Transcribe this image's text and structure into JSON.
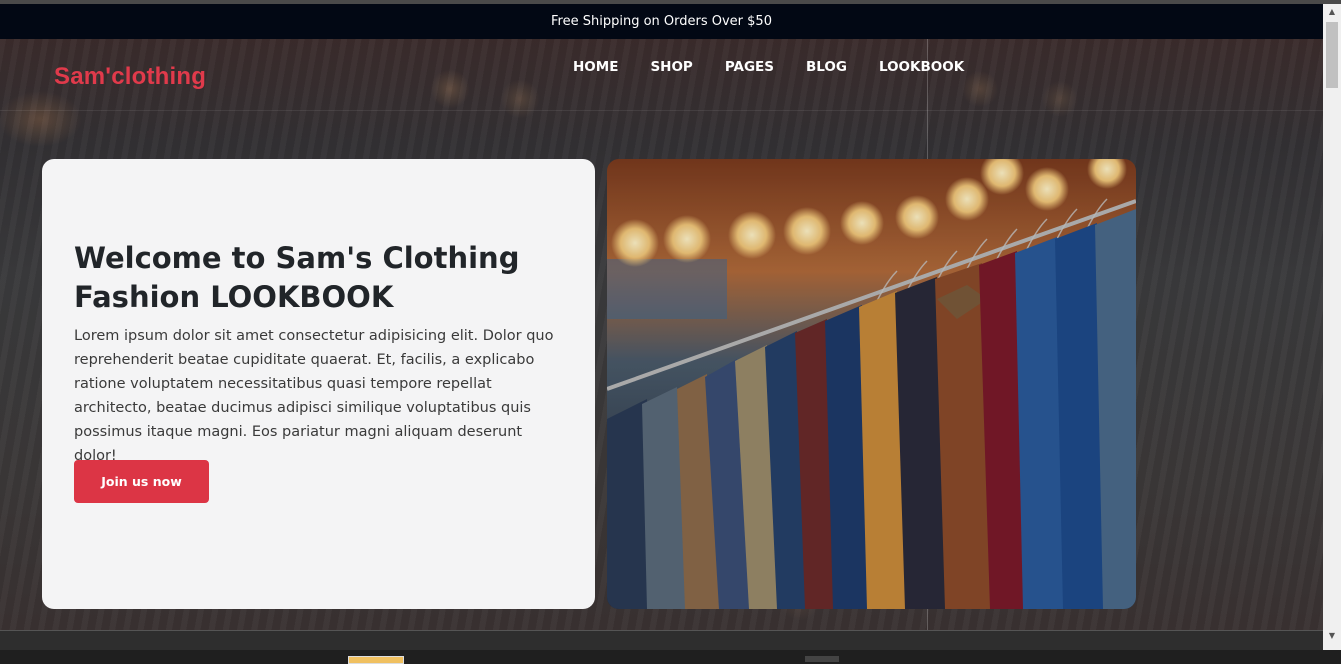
{
  "announcement": "Free Shipping on Orders Over $50",
  "brand": "Sam'clothing",
  "nav": [
    "HOME",
    "SHOP",
    "PAGES",
    "BLOG",
    "LOOKBOOK"
  ],
  "hero": {
    "title": "Welcome to Sam's Clothing Fashion LOOKBOOK",
    "body": "Lorem ipsum dolor sit amet consectetur adipisicing elit. Dolor quo reprehenderit beatae cupiditate quaerat. Et, facilis, a explicabo ratione voluptatem necessitatibus quasi tempore repellat architecto, beatae ducimus adipisci similique voluptatibus quis possimus itaque magni. Eos pariatur magni aliquam deserunt dolor!",
    "cta": "Join us now"
  },
  "colors": {
    "brand": "#e03a4b",
    "cta": "#dc3545",
    "announce_bg": "#020814",
    "card_bg": "#f4f4f5"
  },
  "icons": {
    "scroll_up": "arrow-up-icon",
    "scroll_down": "arrow-down-icon"
  }
}
